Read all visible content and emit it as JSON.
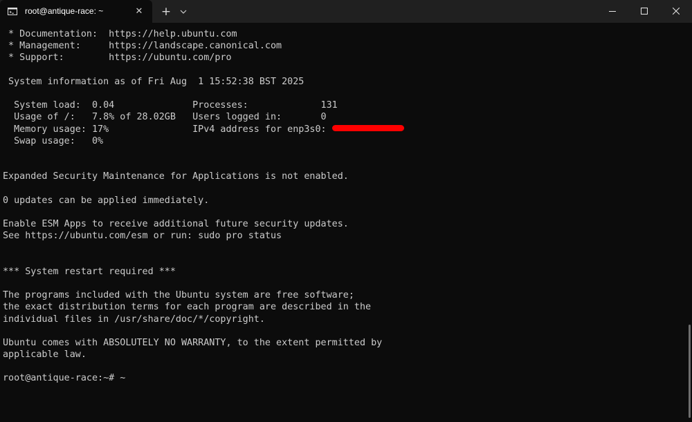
{
  "titlebar": {
    "tab_title": "root@antique-race: ~",
    "tab_close": "✕",
    "new_tab": "+",
    "tab_icon": "terminal-icon",
    "dropdown_icon": "chevron-down-icon"
  },
  "window_controls": {
    "minimize_icon": "minimize-icon",
    "maximize_icon": "maximize-icon",
    "close_icon": "close-icon"
  },
  "terminal": {
    "lines": [
      " * Documentation:  https://help.ubuntu.com",
      " * Management:     https://landscape.canonical.com",
      " * Support:        https://ubuntu.com/pro",
      "",
      " System information as of Fri Aug  1 15:52:38 BST 2025",
      "",
      "  System load:  0.04              Processes:             131",
      "  Usage of /:   7.8% of 28.02GB   Users logged in:       0",
      "  Memory usage: 17%               IPv4 address for enp3s0: ",
      "  Swap usage:   0%",
      "",
      "",
      "Expanded Security Maintenance for Applications is not enabled.",
      "",
      "0 updates can be applied immediately.",
      "",
      "Enable ESM Apps to receive additional future security updates.",
      "See https://ubuntu.com/esm or run: sudo pro status",
      "",
      "",
      "*** System restart required ***",
      "",
      "The programs included with the Ubuntu system are free software;",
      "the exact distribution terms for each program are described in the",
      "individual files in /usr/share/doc/*/copyright.",
      "",
      "Ubuntu comes with ABSOLUTELY NO WARRANTY, to the extent permitted by",
      "applicable law.",
      "",
      "root@antique-race:~# ~"
    ]
  },
  "colors": {
    "background": "#0c0c0c",
    "titlebar": "#202020",
    "text": "#cccccc",
    "redaction": "#ff0000"
  }
}
